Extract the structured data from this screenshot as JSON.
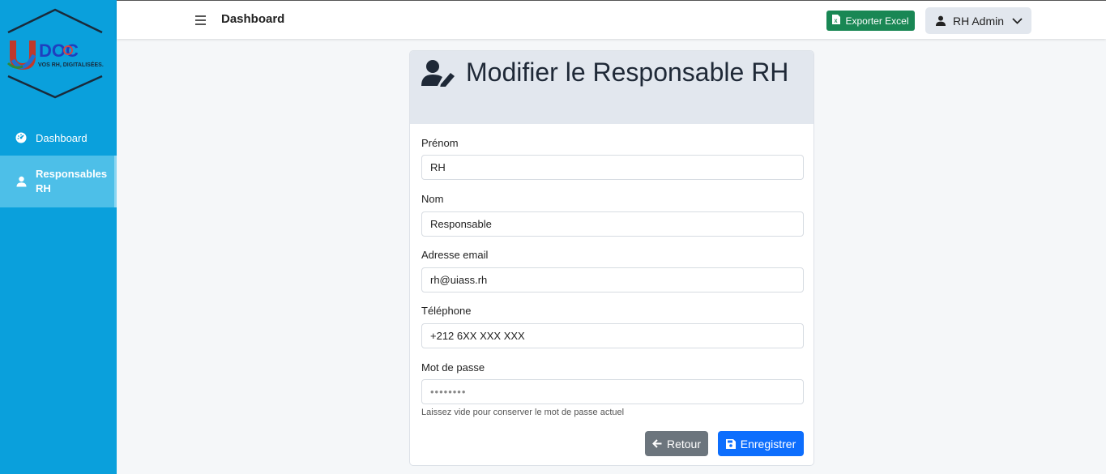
{
  "app": {
    "logo_text": "UDOC",
    "logo_tagline": "VOS RH, DIGITALISÉES."
  },
  "sidebar": {
    "items": [
      {
        "label": "Dashboard",
        "icon": "gauge-icon"
      },
      {
        "label": "Responsables RH",
        "icon": "user-icon"
      }
    ]
  },
  "topbar": {
    "title": "Dashboard",
    "export_label": "Exporter Excel",
    "user_label": "RH Admin"
  },
  "form": {
    "title": "Modifier le Responsable RH",
    "fields": [
      {
        "label": "Prénom",
        "value": "RH"
      },
      {
        "label": "Nom",
        "value": "Responsable"
      },
      {
        "label": "Adresse email",
        "value": "rh@uiass.rh"
      },
      {
        "label": "Téléphone",
        "value": "+212 6XX XXX XXX"
      },
      {
        "label": "Mot de passe",
        "value": "••••••••"
      }
    ],
    "password_help": "Laissez vide pour conserver le mot de passe actuel",
    "back_label": "Retour",
    "save_label": "Enregistrer"
  },
  "colors": {
    "sidebar": "#0aa0dc",
    "sidebar_active": "#4dbfe8",
    "excel_button": "#198754",
    "save_button": "#0d6efd",
    "back_button": "#6c757d"
  }
}
